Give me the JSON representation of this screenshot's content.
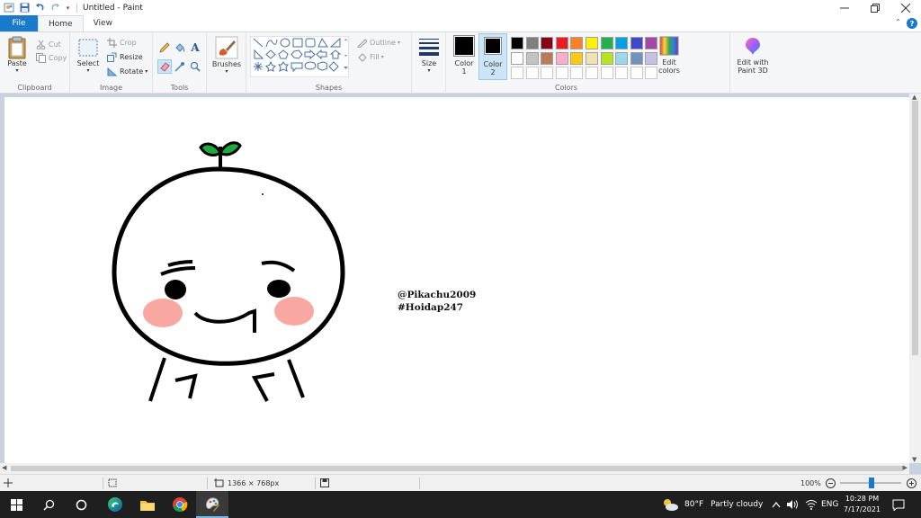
{
  "window": {
    "title": "Untitled - Paint"
  },
  "tabs": [
    {
      "label": "File"
    },
    {
      "label": "Home"
    },
    {
      "label": "View"
    }
  ],
  "ribbon": {
    "clipboard": {
      "label": "Clipboard",
      "paste": "Paste",
      "cut": "Cut",
      "copy": "Copy"
    },
    "image": {
      "label": "Image",
      "select": "Select",
      "crop": "Crop",
      "resize": "Resize",
      "rotate": "Rotate"
    },
    "tools": {
      "label": "Tools"
    },
    "brushes": {
      "label": "Brushes"
    },
    "shapes": {
      "label": "Shapes",
      "outline": "Outline",
      "fill": "Fill"
    },
    "size": {
      "label": "Size"
    },
    "colors": {
      "label": "Colors",
      "color1": "Color 1",
      "color1_line1": "Color",
      "color1_line2": "1",
      "color2_line1": "Color",
      "color2_line2": "2",
      "edit_line1": "Edit",
      "edit_line2": "colors",
      "paint3d_line1": "Edit with",
      "paint3d_line2": "Paint 3D",
      "palette_row1": [
        "#000000",
        "#7f7f7f",
        "#880015",
        "#ed1c24",
        "#ff7f27",
        "#fff200",
        "#22b14c",
        "#00a2e8",
        "#3f48cc",
        "#a349a4"
      ],
      "palette_row2": [
        "#ffffff",
        "#c3c3c3",
        "#b97a57",
        "#ffaec9",
        "#ffc90e",
        "#efe4b0",
        "#b5e61d",
        "#99d9ea",
        "#7092be",
        "#c8bfe7"
      ]
    }
  },
  "canvas": {
    "text_line1": "@Pikachu2009",
    "text_line2": "#Hoidap247"
  },
  "statusbar": {
    "dimensions": "1366 × 768px",
    "zoom": "100%"
  },
  "taskbar": {
    "weather_temp": "80°F",
    "weather_desc": "Partly cloudy",
    "lang": "ENG",
    "time": "10:28 PM",
    "date": "7/17/2021"
  }
}
